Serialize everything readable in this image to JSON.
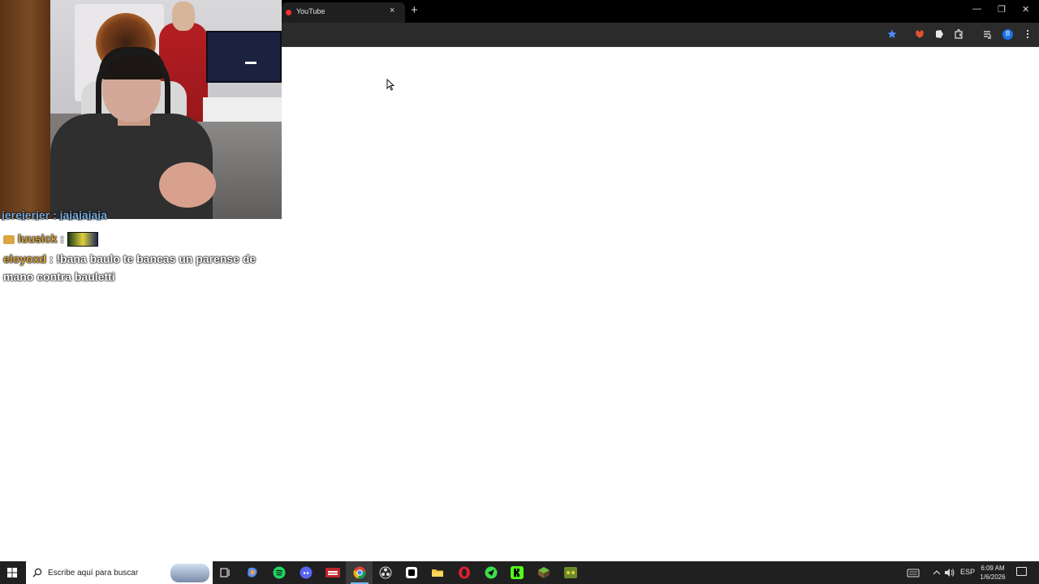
{
  "chat": {
    "partial_line": "jerejerjer : jajajajaja",
    "line2_user": "luusick",
    "line2_sep": ":",
    "line3_user": "eloyoxd",
    "line3_text": ": !bana baulo te bancas un parense de mano contra bauletti"
  },
  "browser": {
    "tab_title": "YouTube",
    "tab_close": "×",
    "new_tab": "+",
    "window_controls": {
      "minimize": "—",
      "restore": "❐",
      "close": "✕"
    },
    "profile_initial": "B"
  },
  "taskbar": {
    "search_placeholder": "Escribe aquí para buscar",
    "language": "ESP",
    "time": "6:09 AM",
    "date": "1/6/2026"
  },
  "colors": {
    "tab_bg": "#1f1f1f",
    "toolbar_bg": "#2b2b2b",
    "taskbar_bg": "#202020",
    "chat_user_gold": "#d9a640",
    "bookmark_star": "#4c8df6"
  }
}
